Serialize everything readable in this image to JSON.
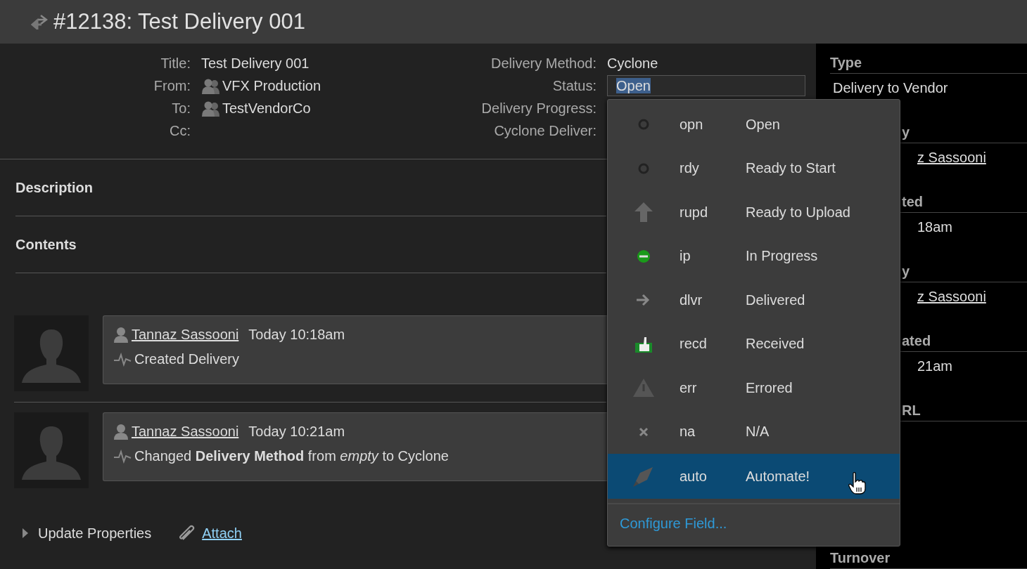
{
  "header": {
    "title": "#12138: Test Delivery 001"
  },
  "fields_left": [
    {
      "label": "Title:",
      "value": "Test Delivery 001",
      "kind": "text"
    },
    {
      "label": "From:",
      "value": "VFX Production",
      "kind": "group"
    },
    {
      "label": "To:",
      "value": "TestVendorCo",
      "kind": "group"
    },
    {
      "label": "Cc:"
    }
  ],
  "fields_right": [
    {
      "label": "Delivery Method:",
      "value": "Cyclone",
      "kind": "text"
    },
    {
      "label": "Status:",
      "value": "Open",
      "kind": "dropdown",
      "highlighted": true
    },
    {
      "label": "Delivery Progress:"
    },
    {
      "label": "Cyclone Deliver:"
    }
  ],
  "sections": [
    "Description",
    "Contents"
  ],
  "activity": [
    {
      "user": "Tannaz Sassooni",
      "time": "Today 10:18am",
      "message": "Created Delivery"
    },
    {
      "user": "Tannaz Sassooni",
      "time": "Today 10:21am",
      "message": "Changed **Delivery Method** from *empty* to Cyclone"
    }
  ],
  "footer": {
    "update": "Update Properties",
    "attach": "Attach"
  },
  "status_menu": {
    "items": [
      {
        "code": "opn",
        "label": "Open",
        "kind": "circle",
        "selected": false
      },
      {
        "code": "rdy",
        "label": "Ready to Start",
        "kind": "circle",
        "selected": false
      },
      {
        "code": "rupd",
        "label": "Ready to Upload",
        "kind": "up",
        "selected": false
      },
      {
        "code": "ip",
        "label": "In Progress",
        "kind": "minus",
        "selected": false
      },
      {
        "code": "dlvr",
        "label": "Delivered",
        "kind": "arrow",
        "selected": false
      },
      {
        "code": "recd",
        "label": "Received",
        "kind": "thumb",
        "selected": false
      },
      {
        "code": "err",
        "label": "Errored",
        "kind": "warning",
        "selected": false
      },
      {
        "code": "na",
        "label": "N/A",
        "kind": "x",
        "selected": false
      },
      {
        "code": "auto",
        "label": "Automate!",
        "kind": "rocket",
        "selected": true
      }
    ],
    "configure": "Configure Field..."
  },
  "sidebar": [
    {
      "heading": "Type",
      "value": "Delivery to Vendor",
      "covered": false,
      "kind": "text"
    },
    {
      "heading": "y",
      "value": "z Sassooni",
      "covered": true,
      "kind": "link"
    },
    {
      "heading": "ted",
      "value": "18am",
      "covered": true,
      "kind": "text"
    },
    {
      "heading": "y",
      "value": "z Sassooni",
      "covered": true,
      "kind": "link"
    },
    {
      "heading": "ated",
      "value": "21am",
      "covered": true,
      "kind": "text"
    },
    {
      "heading": "RL",
      "covered": true
    },
    {
      "heading": "Turnover",
      "covered": false
    }
  ]
}
